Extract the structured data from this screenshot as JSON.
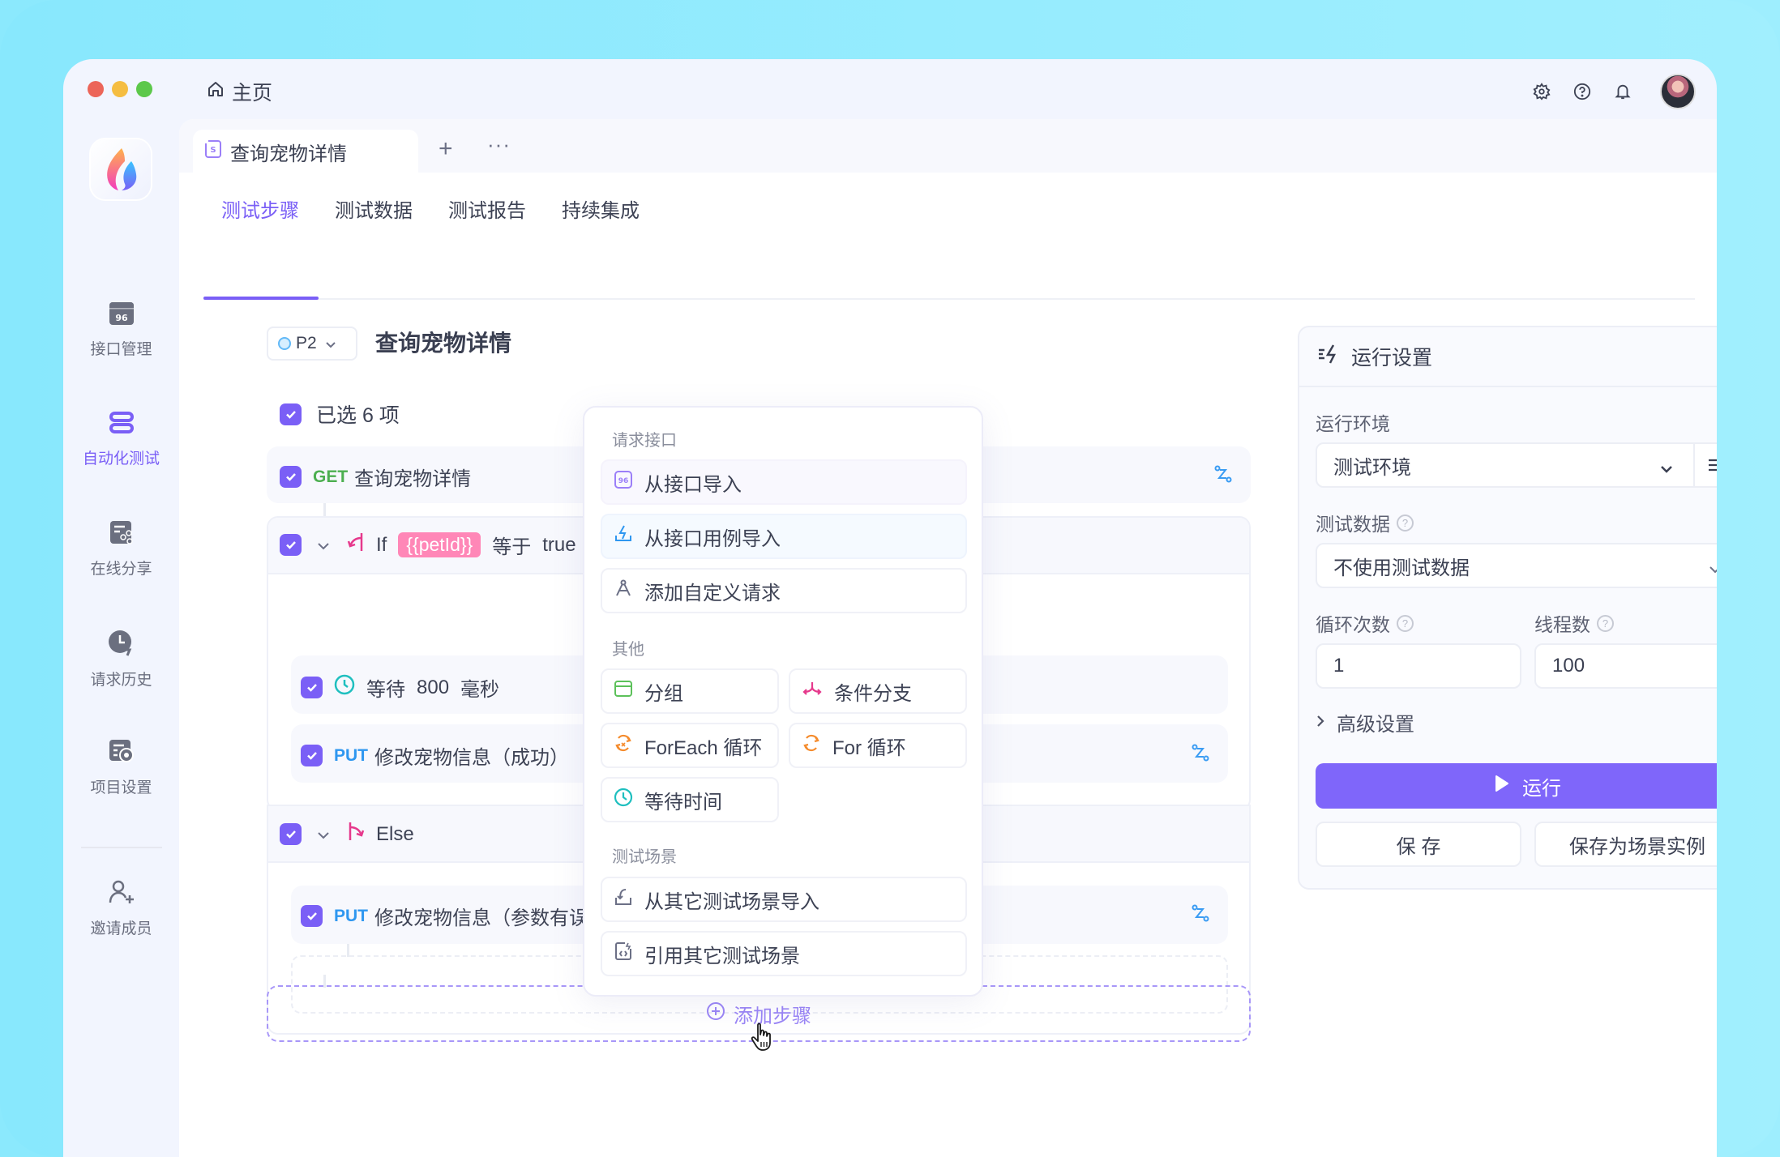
{
  "window": {
    "traffic_lights": {
      "close": "#ec6559",
      "minimize": "#f5bd41",
      "maximize": "#5cc84a"
    },
    "home_label": "主页",
    "top_icons": [
      "gear-icon",
      "help-icon",
      "bell-icon",
      "user-avatar"
    ]
  },
  "sidebar": {
    "items": [
      {
        "label": "接口管理",
        "icon": "api-icon",
        "active": false
      },
      {
        "label": "自动化测试",
        "icon": "automation-icon",
        "active": true
      },
      {
        "label": "在线分享",
        "icon": "share-icon",
        "active": false
      },
      {
        "label": "请求历史",
        "icon": "history-icon",
        "active": false
      },
      {
        "label": "项目设置",
        "icon": "project-settings-icon",
        "active": false
      },
      {
        "label": "邀请成员",
        "icon": "invite-member-icon",
        "active": false
      }
    ]
  },
  "doc_tabs": {
    "active_tab": "查询宠物详情",
    "add_label": "+",
    "more_label": "···"
  },
  "subtabs": [
    {
      "label": "测试步骤",
      "active": true
    },
    {
      "label": "测试数据",
      "active": false
    },
    {
      "label": "测试报告",
      "active": false
    },
    {
      "label": "持续集成",
      "active": false
    }
  ],
  "case": {
    "priority": "P2",
    "title": "查询宠物详情",
    "selected_text": "已选 6 项"
  },
  "steps": {
    "get_row": {
      "method": "GET",
      "name": "查询宠物详情"
    },
    "if_row": {
      "keyword": "If",
      "variable": "{{petId}}",
      "operator": "等于",
      "value": "true"
    },
    "wait_row": {
      "prefix": "等待",
      "value": "800",
      "unit": "毫秒"
    },
    "put_success": {
      "method": "PUT",
      "name": "修改宠物信息（成功）"
    },
    "else_row": {
      "keyword": "Else"
    },
    "put_invalid": {
      "method": "PUT",
      "name": "修改宠物信息（参数有误）"
    },
    "add_step_label": "添加步骤"
  },
  "popup": {
    "sections": [
      {
        "title": "请求接口",
        "items": [
          "从接口导入",
          "从接口用例导入",
          "添加自定义请求"
        ]
      },
      {
        "title": "其他",
        "items": [
          "分组",
          "条件分支",
          "ForEach 循环",
          "For 循环",
          "等待时间"
        ]
      },
      {
        "title": "测试场景",
        "items": [
          "从其它测试场景导入",
          "引用其它测试场景"
        ]
      }
    ]
  },
  "run_settings": {
    "title": "运行设置",
    "env_label": "运行环境",
    "env_value": "测试环境",
    "data_label": "测试数据",
    "data_value": "不使用测试数据",
    "loop_label": "循环次数",
    "loop_value": "1",
    "threads_label": "线程数",
    "threads_value": "100",
    "advanced_label": "高级设置",
    "run_label": "运行",
    "save_label": "保 存",
    "save_as_label": "保存为场景实例",
    "accent": "#7f66fa"
  }
}
